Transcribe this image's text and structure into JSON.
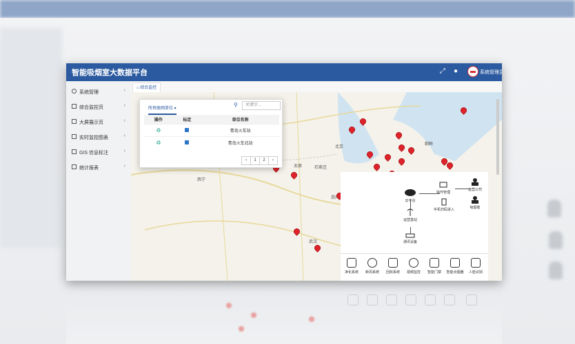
{
  "app": {
    "title": "智能吸烟室大数据平台",
    "user": "系统管理员"
  },
  "icons": {
    "menu": "menu-icon",
    "fullscreen": "expand-icon",
    "chat": "chat-icon",
    "logo": "brand-logo"
  },
  "sidebar": {
    "items": [
      {
        "label": "系统管理",
        "icon": "gear-icon"
      },
      {
        "label": "综合监控页",
        "icon": "monitor-icon"
      },
      {
        "label": "大屏展示页",
        "icon": "screen-icon"
      },
      {
        "label": "实时监控图表",
        "icon": "chart-icon"
      },
      {
        "label": "GIS 信息标注",
        "icon": "map-icon"
      },
      {
        "label": "统计报表",
        "icon": "report-icon"
      }
    ]
  },
  "tabs": {
    "active": "综合监控"
  },
  "panel": {
    "tab_label": "所有联网单位 ▾",
    "search_placeholder": "关键字...",
    "columns": [
      "操作",
      "标定",
      "单位名称"
    ],
    "rows": [
      {
        "name": "青岛火车站"
      },
      {
        "name": "青岛火车北站"
      }
    ],
    "pager": [
      "‹",
      "1",
      "2",
      "›"
    ]
  },
  "map": {
    "cities": [
      "北京",
      "朝鲜",
      "西宁",
      "太原",
      "石家庄",
      "武汉",
      "郑州"
    ]
  },
  "overlay": {
    "cloud_label": "云平台",
    "ops_label": "操作管理",
    "phone_label": "手机扫码进入",
    "ops_company": "运营公司",
    "admin_label": "吸烟者",
    "station_label": "运营基站",
    "control_label": "通讯设备",
    "tools": [
      "净化系统",
      "新风系统",
      "回收系统",
      "视频监控",
      "智能门禁",
      "智能点烟器",
      "人脸识别"
    ]
  },
  "colors": {
    "header": "#2b5aa0",
    "pin": "#e0232a"
  }
}
